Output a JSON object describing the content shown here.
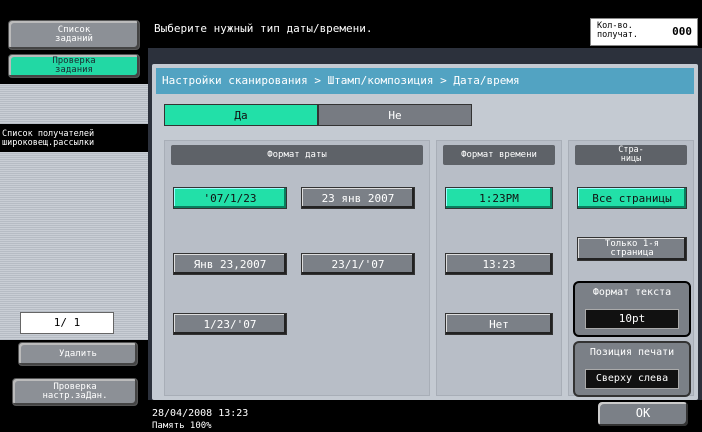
{
  "sidebar": {
    "job_list_label": "Список\nзаданий",
    "job_check_label": "Проверка\nзадания",
    "recipient_list_label": "Список получателей\nшироковещ.рассылки",
    "page_counter": "1/  1",
    "delete_label": "Удалить",
    "check_settings_label": "Проверка\nнастр.заДан."
  },
  "header": {
    "message": "Выберите нужный тип даты/времени.",
    "count_label": "Кол-во.\nполучат.",
    "count_value": "000"
  },
  "breadcrumb": "Настройки сканирования > Штамп/композиция > Дата/время",
  "toggle": {
    "yes": "Да",
    "no": "Не",
    "selected": "yes"
  },
  "date_format": {
    "header": "Формат даты",
    "options": [
      "'07/1/23",
      "23 янв 2007",
      "Янв 23,2007",
      "23/1/'07",
      "1/23/'07"
    ],
    "selected": "'07/1/23"
  },
  "time_format": {
    "header": "Формат времени",
    "options": [
      "1:23PM",
      "13:23",
      "Нет"
    ],
    "selected": "1:23PM"
  },
  "pages": {
    "header": "Стра-\nницы",
    "all_pages": "Все страницы",
    "first_page_only": "Только 1-я\nстраница",
    "selected": "all_pages"
  },
  "text_format": {
    "title": "Формат текста",
    "value": "10pt"
  },
  "print_position": {
    "title": "Позиция печати",
    "value": "Сверху слева"
  },
  "footer": {
    "datetime": "28/04/2008   13:23",
    "memory": "Память      100%",
    "ok_label": "OK"
  },
  "colors": {
    "accent_green": "#22e0a8",
    "breadcrumb_blue": "#52a3c2",
    "button_gray": "#7b8087"
  }
}
